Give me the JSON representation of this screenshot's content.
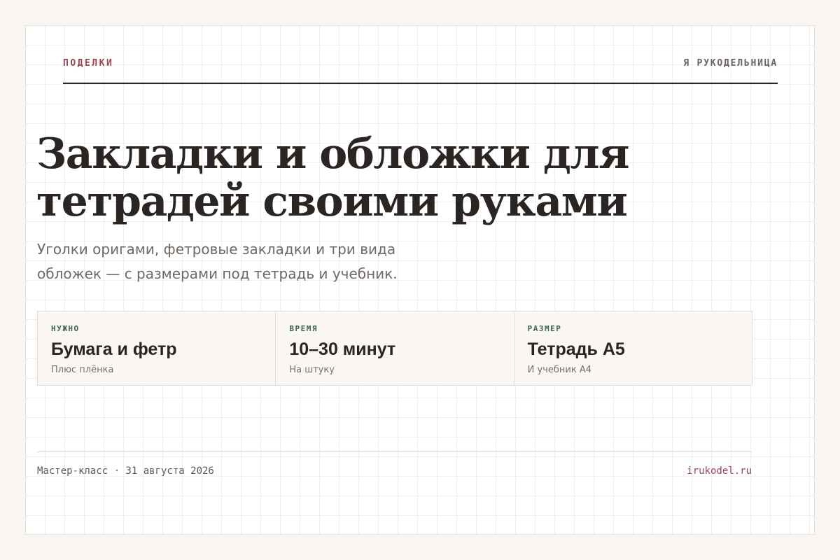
{
  "header": {
    "kicker": "ПОДЕЛКИ",
    "brand": "Я РУКОДЕЛЬНИЦА"
  },
  "title": {
    "line1": "Закладки и обложки для",
    "line2": "тетрадей своими руками"
  },
  "subtitle": {
    "line1": "Уголки оригами, фетровые закладки и три вида",
    "line2": "обложек — с размерами под тетрадь и учебник."
  },
  "stats": [
    {
      "label": "НУЖНО",
      "value": "Бумага и фетр",
      "note": "Плюс плёнка"
    },
    {
      "label": "ВРЕМЯ",
      "value": "10–30 минут",
      "note": "На штуку"
    },
    {
      "label": "РАЗМЕР",
      "value": "Тетрадь А5",
      "note": "И учебник А4"
    }
  ],
  "footer": {
    "left": "Мастер-класс · 31 августа 2026",
    "right": "irukodel.ru"
  },
  "colors": {
    "accent": "#9a4553",
    "label_green": "#3f6354",
    "text_dark": "#2a2522"
  }
}
